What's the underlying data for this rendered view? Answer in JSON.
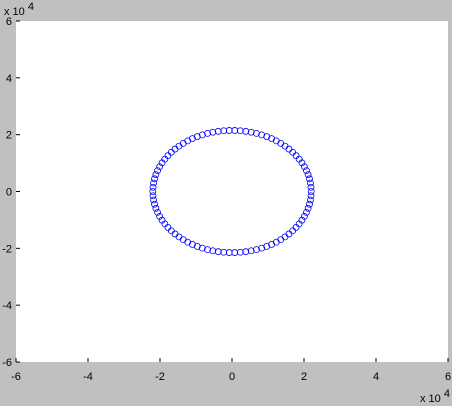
{
  "chart_data": {
    "type": "scatter",
    "title": "",
    "xlabel": "",
    "ylabel": "",
    "xlim": [
      -60000,
      60000
    ],
    "ylim": [
      -60000,
      60000
    ],
    "x_ticks": [
      -60000,
      -40000,
      -20000,
      0,
      20000,
      40000,
      60000
    ],
    "y_ticks": [
      -60000,
      -40000,
      -20000,
      0,
      20000,
      40000,
      60000
    ],
    "x_tick_labels": [
      "-6",
      "-4",
      "-2",
      "0",
      "2",
      "4",
      "6"
    ],
    "y_tick_labels": [
      "-6",
      "-4",
      "-2",
      "0",
      "2",
      "4",
      "6"
    ],
    "x_multiplier": {
      "base": "x 10",
      "exponent": "4"
    },
    "y_multiplier": {
      "base": "x 10",
      "exponent": "4"
    },
    "grid": false,
    "marker": "circle",
    "series": [
      {
        "color": "#0000ff",
        "shape": "ellipse",
        "center": [
          0,
          0
        ],
        "semi_axis_x": 22000,
        "semi_axis_y": 21500,
        "point_count": 90
      }
    ]
  },
  "colors": {
    "figure_background": "#c0c0c0",
    "axes_background": "#ffffff",
    "axes_color": "#000000",
    "series_color": "#0000ff"
  }
}
